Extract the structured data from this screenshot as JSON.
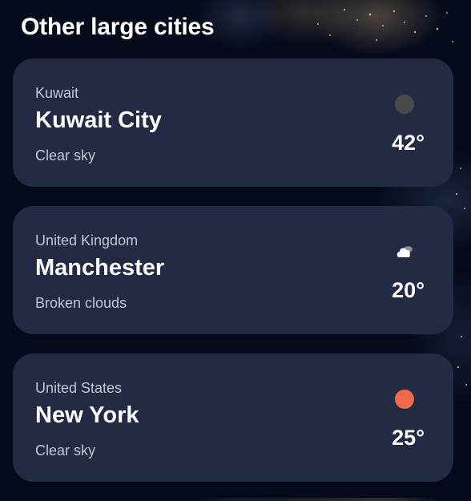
{
  "page": {
    "title": "Other large cities"
  },
  "cities": [
    {
      "country": "Kuwait",
      "city": "Kuwait City",
      "condition": "Clear sky",
      "temperature": "42°",
      "icon": "moon-icon",
      "icon_color": "#4a4a4a"
    },
    {
      "country": "United Kingdom",
      "city": "Manchester",
      "condition": "Broken clouds",
      "temperature": "20°",
      "icon": "broken-clouds-icon",
      "icon_color": "#ffffff"
    },
    {
      "country": "United States",
      "city": "New York",
      "condition": "Clear sky",
      "temperature": "25°",
      "icon": "sun-icon",
      "icon_color": "#ef6a4c"
    }
  ],
  "colors": {
    "background": "#050a1b",
    "card": "#222a44",
    "muted_text": "#c2c7d4"
  }
}
